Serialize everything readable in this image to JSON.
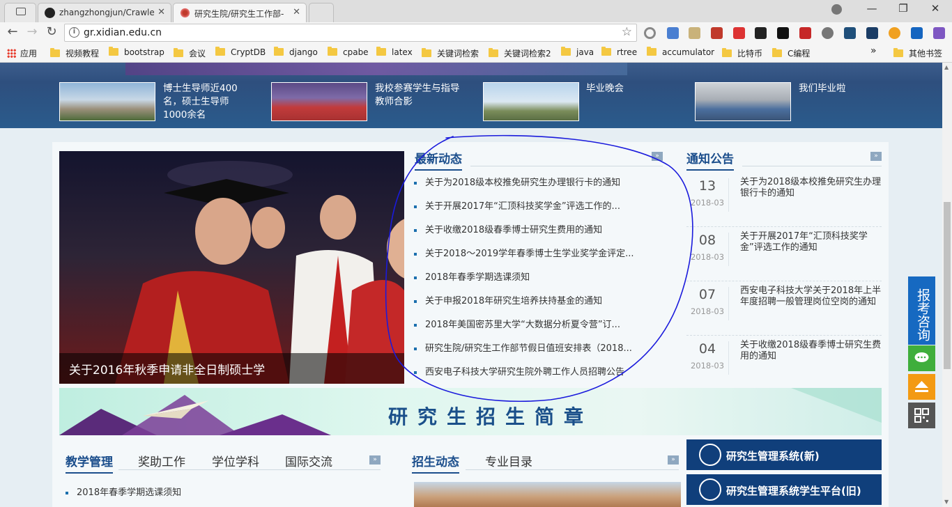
{
  "browser": {
    "tabs": [
      {
        "label": "",
        "icon": "window-icon"
      },
      {
        "label": "zhangzhongjun/Crawle",
        "icon": "github-icon"
      },
      {
        "label": "研究生院/研究生工作部-",
        "icon": "xidian-logo-icon"
      }
    ],
    "window_controls": {
      "minimize": "—",
      "restore": "❐",
      "close": "✕"
    },
    "url": "gr.xidian.edu.cn",
    "bookmarks": [
      {
        "label": "应用"
      },
      {
        "label": "视频教程"
      },
      {
        "label": "bootstrap"
      },
      {
        "label": "会议"
      },
      {
        "label": "CryptDB"
      },
      {
        "label": "django"
      },
      {
        "label": "cpabe"
      },
      {
        "label": "latex"
      },
      {
        "label": "关键词检索"
      },
      {
        "label": "关键词检索2"
      },
      {
        "label": "java"
      },
      {
        "label": "rtree"
      },
      {
        "label": "accumulator"
      },
      {
        "label": "比特币"
      },
      {
        "label": "C编程"
      },
      {
        "label": "»"
      },
      {
        "label": "其他书签"
      }
    ]
  },
  "banner": {
    "items": [
      {
        "caption": "博士生导师近400名，硕士生导师1000余名"
      },
      {
        "caption": "我校参赛学生与指导教师合影"
      },
      {
        "caption": "毕业晚会"
      },
      {
        "caption": "我们毕业啦"
      }
    ]
  },
  "feature": {
    "caption": "关于2016年秋季申请非全日制硕士学"
  },
  "latest_news": {
    "title": "最新动态",
    "more": "»",
    "items": [
      "关于为2018级本校推免研究生办理银行卡的通知",
      "关于开展2017年“汇顶科技奖学金”评选工作的...",
      "关于收缴2018级春季博士研究生费用的通知",
      "关于2018～2019学年春季博士生学业奖学金评定...",
      "2018年春季学期选课须知",
      "关于申报2018年研究生培养扶持基金的通知",
      "2018年美国密苏里大学“大数据分析夏令营”订...",
      "研究生院/研究生工作部节假日值班安排表（2018...",
      "西安电子科技大学研究生院外聘工作人员招聘公告"
    ]
  },
  "notices": {
    "title": "通知公告",
    "more": "»",
    "items": [
      {
        "day": "13",
        "ym": "2018-03",
        "text": "关于为2018级本校推免研究生办理银行卡的通知"
      },
      {
        "day": "08",
        "ym": "2018-03",
        "text": "关于开展2017年“汇顶科技奖学金”评选工作的通知"
      },
      {
        "day": "07",
        "ym": "2018-03",
        "text": "西安电子科技大学关于2018年上半年度招聘一般管理岗位空岗的通知"
      },
      {
        "day": "04",
        "ym": "2018-03",
        "text": "关于收缴2018级春季博士研究生费用的通知"
      }
    ]
  },
  "recruit_banner": {
    "title": "研究生招生简章"
  },
  "bottom_tabs_left": [
    "教学管理",
    "奖助工作",
    "学位学科",
    "国际交流"
  ],
  "bottom_tabs_right": [
    "招生动态",
    "专业目录"
  ],
  "bottom_more": "»",
  "teaching_list": [
    "2018年春季学期选课须知"
  ],
  "systems": [
    {
      "label": "研究生管理系统(新)"
    },
    {
      "label": "研究生管理系统学生平台(旧)"
    }
  ],
  "float_sidebar": {
    "consult": "报考咨询"
  },
  "colors": {
    "brand_blue": "#1b4e8c",
    "nav_dark": "#103f7b",
    "consult_blue": "#1669c1",
    "chat_green": "#3fae3c",
    "top_orange": "#f39a13",
    "annotation_ink": "#1a1adc"
  }
}
